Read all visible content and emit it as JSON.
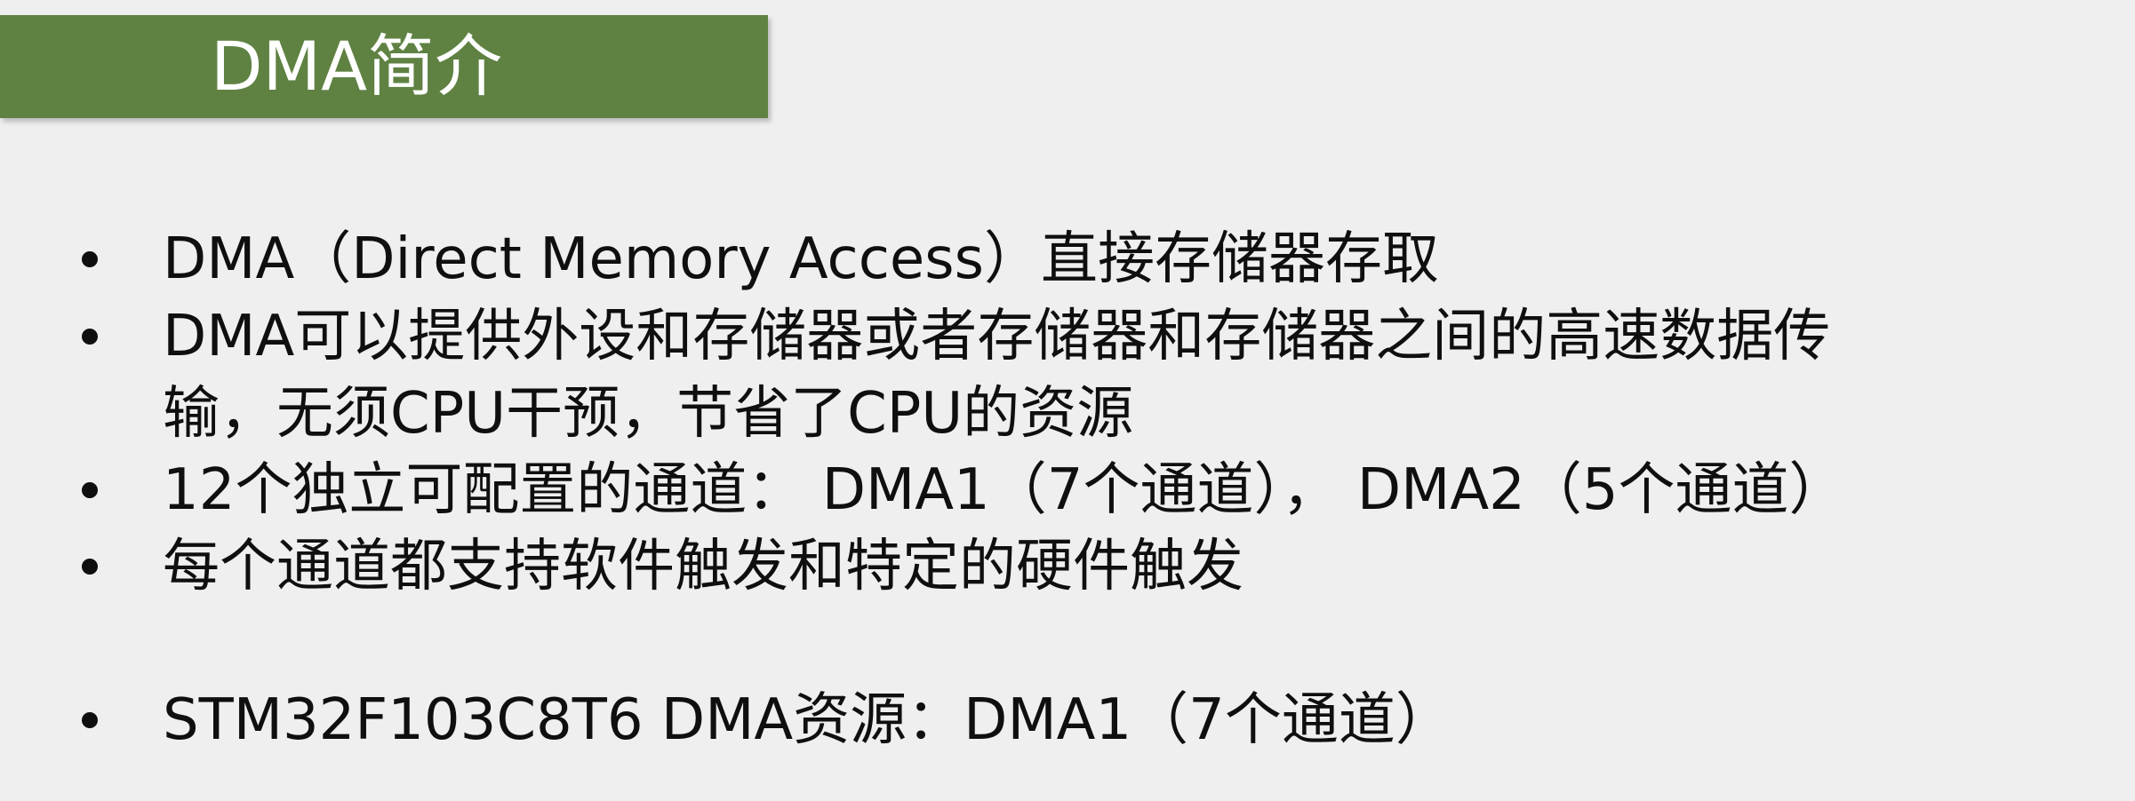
{
  "slide": {
    "title": "DMA简介",
    "bullets": [
      {
        "lines": [
          "DMA（Direct Memory Access）直接存储器存取"
        ]
      },
      {
        "lines": [
          "DMA可以提供外设和存储器或者存储器和存储器之间的高速数据传",
          "输，无须CPU干预，节省了CPU的资源"
        ]
      },
      {
        "lines": [
          "12个独立可配置的通道： DMA1（7个通道）， DMA2（5个通道）"
        ]
      },
      {
        "lines": [
          "每个通道都支持软件触发和特定的硬件触发"
        ]
      },
      {
        "lines": [
          "STM32F103C8T6 DMA资源：DMA1（7个通道）"
        ]
      }
    ]
  }
}
